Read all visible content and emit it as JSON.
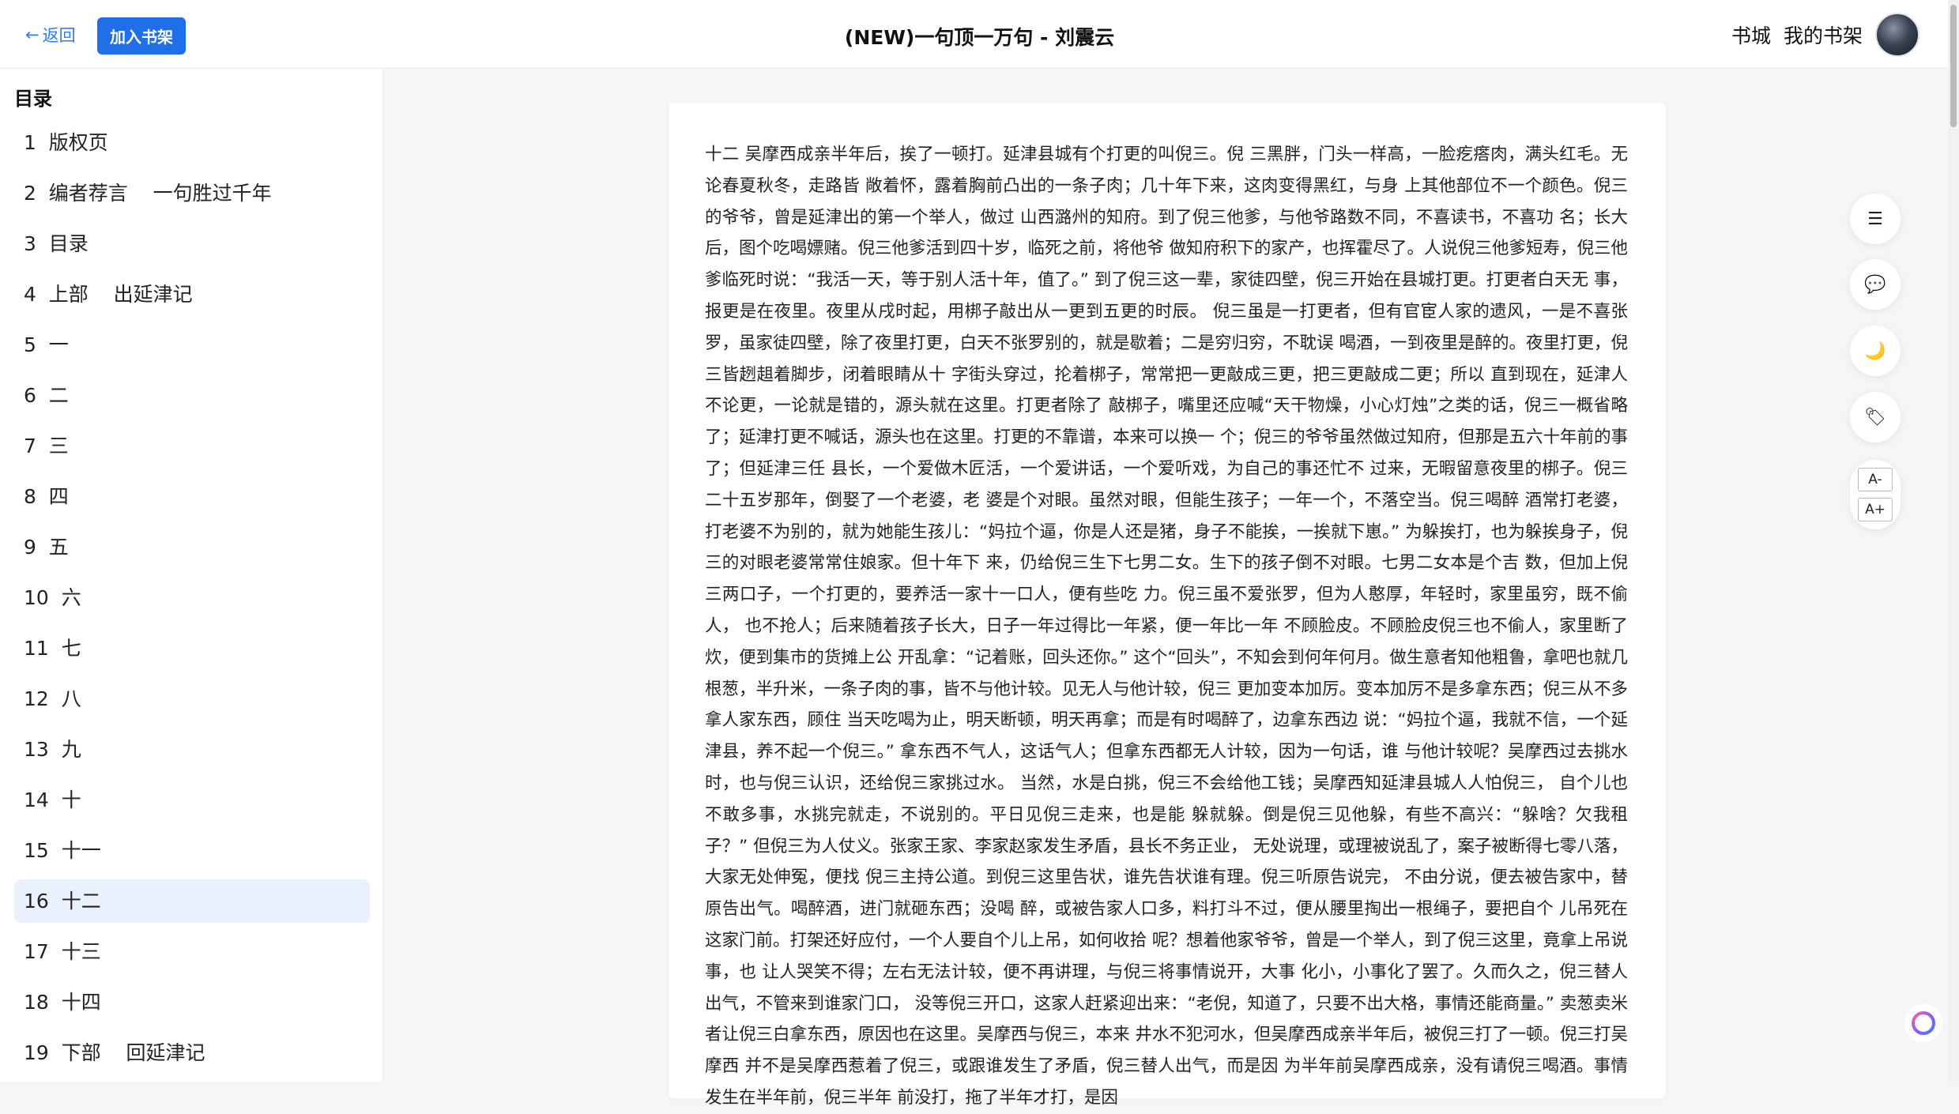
{
  "header": {
    "back_label": "返回",
    "add_shelf_label": "加入书架",
    "book_title": "(NEW)一句顶一万句 - 刘震云",
    "nav": [
      "书城",
      "我的书架"
    ]
  },
  "toc": {
    "title": "目录",
    "active_index": 15,
    "items": [
      "1  版权页",
      "2  编者荐言    一句胜过千年",
      "3  目录",
      "4  上部    出延津记",
      "5  一",
      "6  二",
      "7  三",
      "8  四",
      "9  五",
      "10  六",
      "11  七",
      "12  八",
      "13  九",
      "14  十",
      "15  十一",
      "16  十二",
      "17  十三",
      "18  十四",
      "19  下部    回延津记"
    ]
  },
  "content": {
    "text": "十二 吴摩西成亲半年后，挨了一顿打。延津县城有个打更的叫倪三。倪 三黑胖，门头一样高，一脸疙瘩肉，满头红毛。无论春夏秋冬，走路皆 敞着怀，露着胸前凸出的一条子肉；几十年下来，这肉变得黑红，与身 上其他部位不一个颜色。倪三的爷爷，曾是延津出的第一个举人，做过 山西潞州的知府。到了倪三他爹，与他爷路数不同，不喜读书，不喜功 名；长大后，图个吃喝嫖赌。倪三他爹活到四十岁，临死之前，将他爷 做知府积下的家产，也挥霍尽了。人说倪三他爹短寿，倪三他爹临死时说：“我活一天，等于别人活十年，值了。” 到了倪三这一辈，家徒四壁，倪三开始在县城打更。打更者白天无 事，报更是在夜里。夜里从戌时起，用梆子敲出从一更到五更的时辰。 倪三虽是一打更者，但有官宦人家的遗风，一是不喜张罗，虽家徒四壁，除了夜里打更，白天不张罗别的，就是歇着；二是穷归穷，不耽误 喝酒，一到夜里是醉的。夜里打更，倪三皆趔趄着脚步，闭着眼睛从十 字街头穿过，抡着梆子，常常把一更敲成三更，把三更敲成二更；所以 直到现在，延津人不论更，一论就是错的，源头就在这里。打更者除了 敲梆子，嘴里还应喊“天干物燥，小心灯烛”之类的话，倪三一概省略 了；延津打更不喊话，源头也在这里。打更的不靠谱，本来可以换一 个；倪三的爷爷虽然做过知府，但那是五六十年前的事了；但延津三任 县长，一个爱做木匠活，一个爱讲话，一个爱听戏，为自己的事还忙不 过来，无暇留意夜里的梆子。倪三二十五岁那年，倒娶了一个老婆，老 婆是个对眼。虽然对眼，但能生孩子；一年一个，不落空当。倪三喝醉 酒常打老婆，打老婆不为别的，就为她能生孩儿：“妈拉个逼，你是人还是猪，身子不能挨，一挨就下崽。” 为躲挨打，也为躲挨身子，倪三的对眼老婆常常住娘家。但十年下 来，仍给倪三生下七男二女。生下的孩子倒不对眼。七男二女本是个吉 数，但加上倪三两口子，一个打更的，要养活一家十一口人，便有些吃 力。倪三虽不爱张罗，但为人憨厚，年轻时，家里虽穷，既不偷人， 也不抢人；后来随着孩子长大，日子一年过得比一年紧，便一年比一年 不顾脸皮。不顾脸皮倪三也不偷人，家里断了炊，便到集市的货摊上公 开乱拿：“记着账，回头还你。” 这个“回头”，不知会到何年何月。做生意者知他粗鲁，拿吧也就几 根葱，半升米，一条子肉的事，皆不与他计较。见无人与他计较，倪三 更加变本加厉。变本加厉不是多拿东西；倪三从不多拿人家东西，顾住 当天吃喝为止，明天断顿，明天再拿；而是有时喝醉了，边拿东西边 说：“妈拉个逼，我就不信，一个延津县，养不起一个倪三。” 拿东西不气人，这话气人；但拿东西都无人计较，因为一句话，谁 与他计较呢？吴摩西过去挑水时，也与倪三认识，还给倪三家挑过水。 当然，水是白挑，倪三不会给他工钱；吴摩西知延津县城人人怕倪三， 自个儿也不敢多事，水挑完就走，不说别的。平日见倪三走来，也是能 躲就躲。倒是倪三见他躲，有些不高兴：“躲啥？欠我租子？” 但倪三为人仗义。张家王家、李家赵家发生矛盾，县长不务正业， 无处说理，或理被说乱了，案子被断得七零八落，大家无处伸冤，便找 倪三主持公道。到倪三这里告状，谁先告状谁有理。倪三听原告说完， 不由分说，便去被告家中，替原告出气。喝醉酒，进门就砸东西；没喝 醉，或被告家人口多，料打斗不过，便从腰里掏出一根绳子，要把自个 儿吊死在这家门前。打架还好应付，一个人要自个儿上吊，如何收拾 呢？想着他家爷爷，曾是一个举人，到了倪三这里，竟拿上吊说事，也 让人哭笑不得；左右无法计较，便不再讲理，与倪三将事情说开，大事 化小，小事化了罢了。久而久之，倪三替人出气，不管来到谁家门口， 没等倪三开口，这家人赶紧迎出来：“老倪，知道了，只要不出大格，事情还能商量。” 卖葱卖米者让倪三白拿东西，原因也在这里。吴摩西与倪三，本来 井水不犯河水，但吴摩西成亲半年后，被倪三打了一顿。倪三打吴摩西 并不是吴摩西惹着了倪三，或跟谁发生了矛盾，倪三替人出气，而是因 为半年前吴摩西成亲，没有请倪三喝酒。事情发生在半年前，倪三半年 前没打，拖了半年才打，是因"
  },
  "toolbar": {
    "buttons": [
      {
        "name": "toc-toggle-button",
        "icon": "list-icon",
        "glyph": "☰"
      },
      {
        "name": "comments-button",
        "icon": "chat-bubble-icon",
        "glyph": "💬"
      },
      {
        "name": "night-mode-button",
        "icon": "moon-icon",
        "glyph": "🌙"
      },
      {
        "name": "bookmark-button",
        "icon": "tag-icon",
        "glyph": "🏷"
      }
    ],
    "font_decrease_label": "A-",
    "font_increase_label": "A+"
  },
  "colors": {
    "accent": "#1e6fe8",
    "link": "#2f7cf6",
    "active_row": "#eaf1fd",
    "page_bg": "#f5f6f8"
  }
}
